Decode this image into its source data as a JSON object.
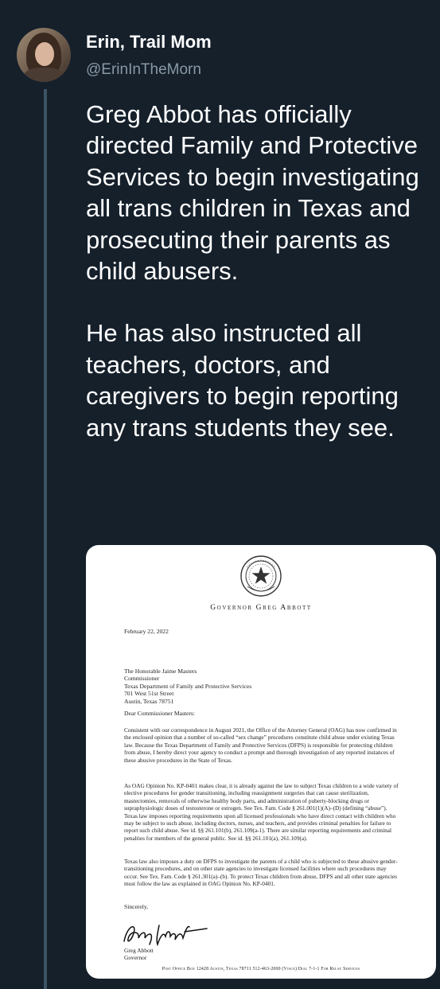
{
  "user": {
    "display_name": "Erin, Trail Mom",
    "handle": "@ErinInTheMorn"
  },
  "tweet": {
    "paragraphs": [
      "Greg Abbot has officially directed Family and Protective Services to begin investigating all trans children in Texas and prosecuting their parents as child abusers.",
      "He has also instructed all teachers, doctors, and caregivers to begin reporting any trans students they see."
    ]
  },
  "document": {
    "letterhead": "Governor Greg Abbott",
    "date": "February 22, 2022",
    "address": [
      "The Honorable Jaime Masters",
      "Commissioner",
      "Texas Department of Family and Protective Services",
      "701 West 51st Street",
      "Austin, Texas 78751"
    ],
    "salutation": "Dear Commissioner Masters:",
    "paragraphs": [
      "Consistent with our correspondence in August 2021, the Office of the Attorney General (OAG) has now confirmed in the enclosed opinion that a number of so-called “sex change” procedures constitute child abuse under existing Texas law. Because the Texas Department of Family and Protective Services (DFPS) is responsible for protecting children from abuse, I hereby direct your agency to conduct a prompt and thorough investigation of any reported instances of these abusive procedures in the State of Texas.",
      "As OAG Opinion No. KP-0401 makes clear, it is already against the law to subject Texas children to a wide variety of elective procedures for gender transitioning, including reassignment surgeries that can cause sterilization, mastectomies, removals of otherwise healthy body parts, and administration of puberty-blocking drugs or supraphysiologic doses of testosterone or estrogen. See Tex. Fam. Code § 261.001(1)(A)–(D) (defining “abuse”). Texas law imposes reporting requirements upon all licensed professionals who have direct contact with children who may be subject to such abuse, including doctors, nurses, and teachers, and provides criminal penalties for failure to report such child abuse. See id. §§ 261.101(b), 261.109(a-1). There are similar reporting requirements and criminal penalties for members of the general public. See id. §§ 261.101(a), 261.109(a).",
      "Texas law also imposes a duty on DFPS to investigate the parents of a child who is subjected to these abusive gender-transitioning procedures, and on other state agencies to investigate licensed facilities where such procedures may occur. See Tex. Fam. Code § 261.301(a)–(b). To protect Texas children from abuse, DFPS and all other state agencies must follow the law as explained in OAG Opinion No. KP-0401."
    ],
    "closing": "Sincerely,",
    "signer_name": "Greg Abbott",
    "signer_title": "Governor",
    "footer": "Post Office Box 12428 Austin, Texas 78711 512-463-2000 (Voice) Dial 7-1-1 For Relay Services"
  }
}
